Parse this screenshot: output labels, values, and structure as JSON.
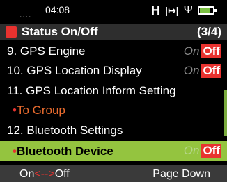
{
  "status_bar": {
    "signal": "....",
    "time": "04:08",
    "network_label": "H",
    "icons": [
      "network-h-icon",
      "transfer-arrow-icon",
      "usb-icon",
      "battery-icon"
    ],
    "battery_level": 0.85
  },
  "header": {
    "title": "Status On/Off",
    "page_indicator": "(3/4)"
  },
  "menu": {
    "items": [
      {
        "label": "9. GPS Engine",
        "on_label": "On",
        "off_label": "Off",
        "state": "Off"
      },
      {
        "label": "10. GPS Location Display",
        "on_label": "On",
        "off_label": "Off",
        "state": "Off"
      },
      {
        "label": "11. GPS Location Inform Setting"
      },
      {
        "bullet": "•",
        "label": "To Group"
      },
      {
        "label": "12. Bluetooth Settings"
      },
      {
        "bullet": "•",
        "label": "Bluetooth Device",
        "on_label": "On",
        "off_label": "Off",
        "state": "Off",
        "selected": true
      }
    ]
  },
  "softkeys": {
    "left_on": "On",
    "left_arrows": "<-->",
    "left_off": "Off",
    "right": "Page Down"
  },
  "colors": {
    "accent_red": "#e8322f",
    "selection_green": "#94c43f",
    "background": "#000000"
  }
}
